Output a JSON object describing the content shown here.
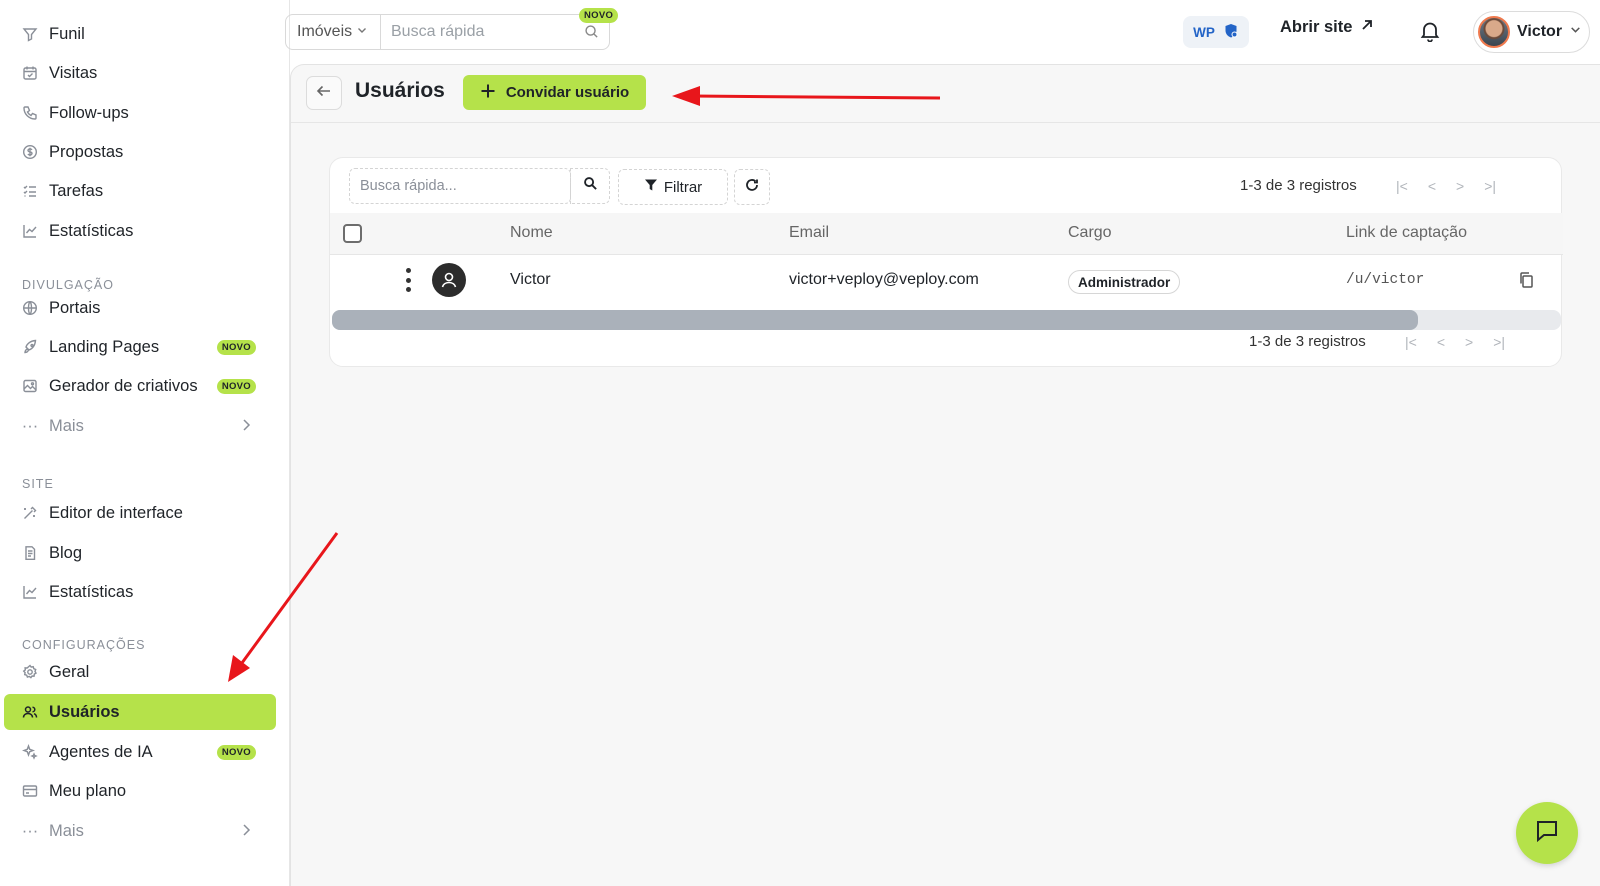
{
  "sidebar": {
    "items_top": [
      {
        "label": "Funil",
        "icon": "filter-icon"
      },
      {
        "label": "Visitas",
        "icon": "calendar-icon"
      },
      {
        "label": "Follow-ups",
        "icon": "phone-icon"
      },
      {
        "label": "Propostas",
        "icon": "dollar-icon"
      },
      {
        "label": "Tarefas",
        "icon": "tasks-icon"
      },
      {
        "label": "Estatísticas",
        "icon": "chart-icon"
      }
    ],
    "section_divulgacao": "DIVULGAÇÃO",
    "items_divulgacao": [
      {
        "label": "Portais",
        "icon": "globe-icon"
      },
      {
        "label": "Landing Pages",
        "icon": "rocket-icon",
        "badge": "NOVO"
      },
      {
        "label": "Gerador de criativos",
        "icon": "image-icon",
        "badge": "NOVO"
      },
      {
        "label": "Mais",
        "icon": "dots-icon"
      }
    ],
    "section_site": "SITE",
    "items_site": [
      {
        "label": "Editor de interface",
        "icon": "wand-icon"
      },
      {
        "label": "Blog",
        "icon": "document-icon"
      },
      {
        "label": "Estatísticas",
        "icon": "chart-icon"
      }
    ],
    "section_config": "CONFIGURAÇÕES",
    "items_config": [
      {
        "label": "Geral",
        "icon": "gear-icon"
      },
      {
        "label": "Usuários",
        "icon": "users-icon",
        "active": true
      },
      {
        "label": "Agentes de IA",
        "icon": "sparkle-icon",
        "badge": "NOVO"
      },
      {
        "label": "Meu plano",
        "icon": "card-icon"
      },
      {
        "label": "Mais",
        "icon": "dots-icon"
      }
    ]
  },
  "topbar": {
    "search_scope": "Imóveis",
    "search_placeholder": "Busca rápida",
    "search_badge": "NOVO",
    "wp_label": "WP",
    "open_site_label": "Abrir site",
    "user_name": "Victor"
  },
  "page": {
    "title": "Usuários",
    "invite_label": "Convidar usuário"
  },
  "table": {
    "search_placeholder": "Busca rápida...",
    "filter_label": "Filtrar",
    "records_label": "1-3 de 3 registros",
    "columns": [
      "Nome",
      "Email",
      "Cargo",
      "Link de captação"
    ],
    "rows": [
      {
        "name": "Victor",
        "email": "victor+veploy@veploy.com",
        "role": "Administrador",
        "link": "/u/victor"
      }
    ]
  },
  "colors": {
    "accent": "#b5e24a",
    "annotation": "#e8161b"
  }
}
